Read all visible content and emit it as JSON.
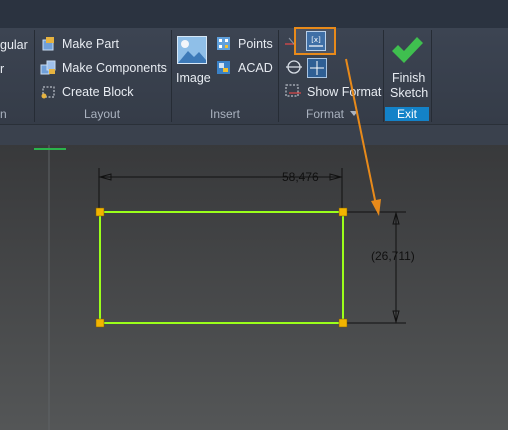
{
  "ribbon": {
    "cut_left_top": "gular",
    "cut_left_mid": "r",
    "cut_left_label": "n",
    "layout": {
      "make_part": "Make Part",
      "make_components": "Make Components",
      "create_block": "Create Block",
      "label": "Layout"
    },
    "insert": {
      "image": "Image",
      "points": "Points",
      "acad": "ACAD",
      "label": "Insert"
    },
    "format": {
      "show_format": "Show Format",
      "label": "Format"
    },
    "exit": {
      "finish_line1": "Finish",
      "finish_line2": "Sketch",
      "label": "Exit"
    }
  },
  "sketch": {
    "horizontal_dim": "58,476",
    "vertical_dim": "(26,711)"
  },
  "colors": {
    "profile_line": "#9bff1a",
    "grip_point": "#f2b400",
    "highlight_box": "#e88a1a",
    "exit_bar": "#1382c8",
    "check_icon": "#3fbf4f"
  }
}
